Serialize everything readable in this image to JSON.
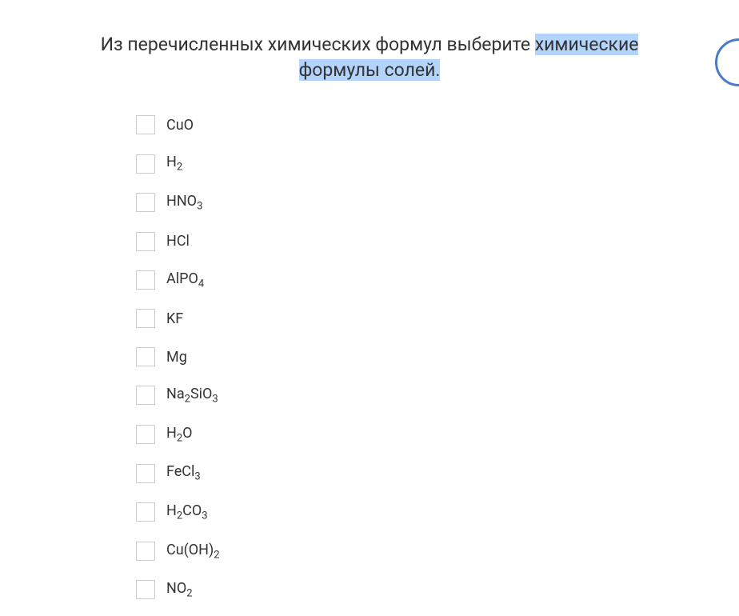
{
  "question": {
    "text_before_highlight": "Из перечисленных химических формул выберите ",
    "highlighted_text": "химические формулы солей."
  },
  "options": [
    {
      "formula_html": "CuO"
    },
    {
      "formula_html": "H<sub>2</sub>"
    },
    {
      "formula_html": "HNO<sub>3</sub>"
    },
    {
      "formula_html": "HCl"
    },
    {
      "formula_html": "AlPO<sub>4</sub>"
    },
    {
      "formula_html": "KF"
    },
    {
      "formula_html": "Mg"
    },
    {
      "formula_html": "Na<sub>2</sub>SiO<sub>3</sub>"
    },
    {
      "formula_html": "H<sub>2</sub>O"
    },
    {
      "formula_html": "FeCl<sub>3</sub>"
    },
    {
      "formula_html": "H<sub>2</sub>CO<sub>3</sub>"
    },
    {
      "formula_html": "Cu(OH)<sub>2</sub>"
    },
    {
      "formula_html": "NO<sub>2</sub>"
    }
  ]
}
